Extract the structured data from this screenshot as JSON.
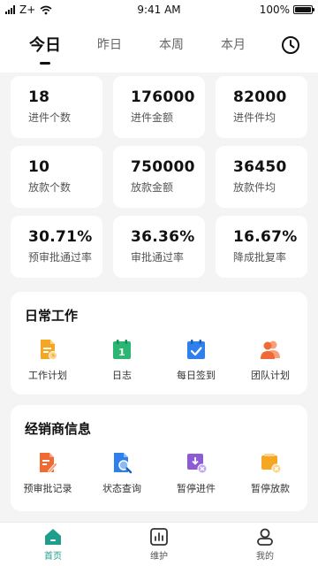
{
  "status_bar": {
    "carrier": "Z+",
    "time": "9:41 AM",
    "battery": "100%"
  },
  "tabs": [
    {
      "label": "今日",
      "active": true
    },
    {
      "label": "昨日",
      "active": false
    },
    {
      "label": "本周",
      "active": false
    },
    {
      "label": "本月",
      "active": false
    }
  ],
  "stats": [
    {
      "value": "18",
      "label": "进件个数"
    },
    {
      "value": "176000",
      "label": "进件金额"
    },
    {
      "value": "82000",
      "label": "进件件均"
    },
    {
      "value": "10",
      "label": "放款个数"
    },
    {
      "value": "750000",
      "label": "放款金额"
    },
    {
      "value": "36450",
      "label": "放款件均"
    },
    {
      "value": "30.71%",
      "label": "预审批通过率"
    },
    {
      "value": "36.36%",
      "label": "审批通过率"
    },
    {
      "value": "16.67%",
      "label": "降成批复率"
    }
  ],
  "daily_work": {
    "title": "日常工作",
    "items": [
      {
        "label": "工作计划",
        "icon": "work-plan-icon",
        "color": "#f5a623"
      },
      {
        "label": "日志",
        "icon": "log-calendar-icon",
        "color": "#2bb673"
      },
      {
        "label": "每日签到",
        "icon": "checkin-calendar-icon",
        "color": "#2f80ed"
      },
      {
        "label": "团队计划",
        "icon": "team-icon",
        "color": "#f06a35"
      }
    ]
  },
  "dealer_info": {
    "title": "经销商信息",
    "items": [
      {
        "label": "预审批记录",
        "icon": "pre-approval-record-icon",
        "color": "#f06a35"
      },
      {
        "label": "状态查询",
        "icon": "status-query-icon",
        "color": "#2f80ed"
      },
      {
        "label": "暂停进件",
        "icon": "pause-intake-icon",
        "color": "#8e5bd6"
      },
      {
        "label": "暂停放款",
        "icon": "pause-loan-icon",
        "color": "#f5a623"
      }
    ]
  },
  "bottom_nav": [
    {
      "label": "首页",
      "icon": "home-icon",
      "active": true
    },
    {
      "label": "维护",
      "icon": "chart-icon",
      "active": false
    },
    {
      "label": "我的",
      "icon": "profile-icon",
      "active": false
    }
  ],
  "accent_color": "#1f9e8b"
}
